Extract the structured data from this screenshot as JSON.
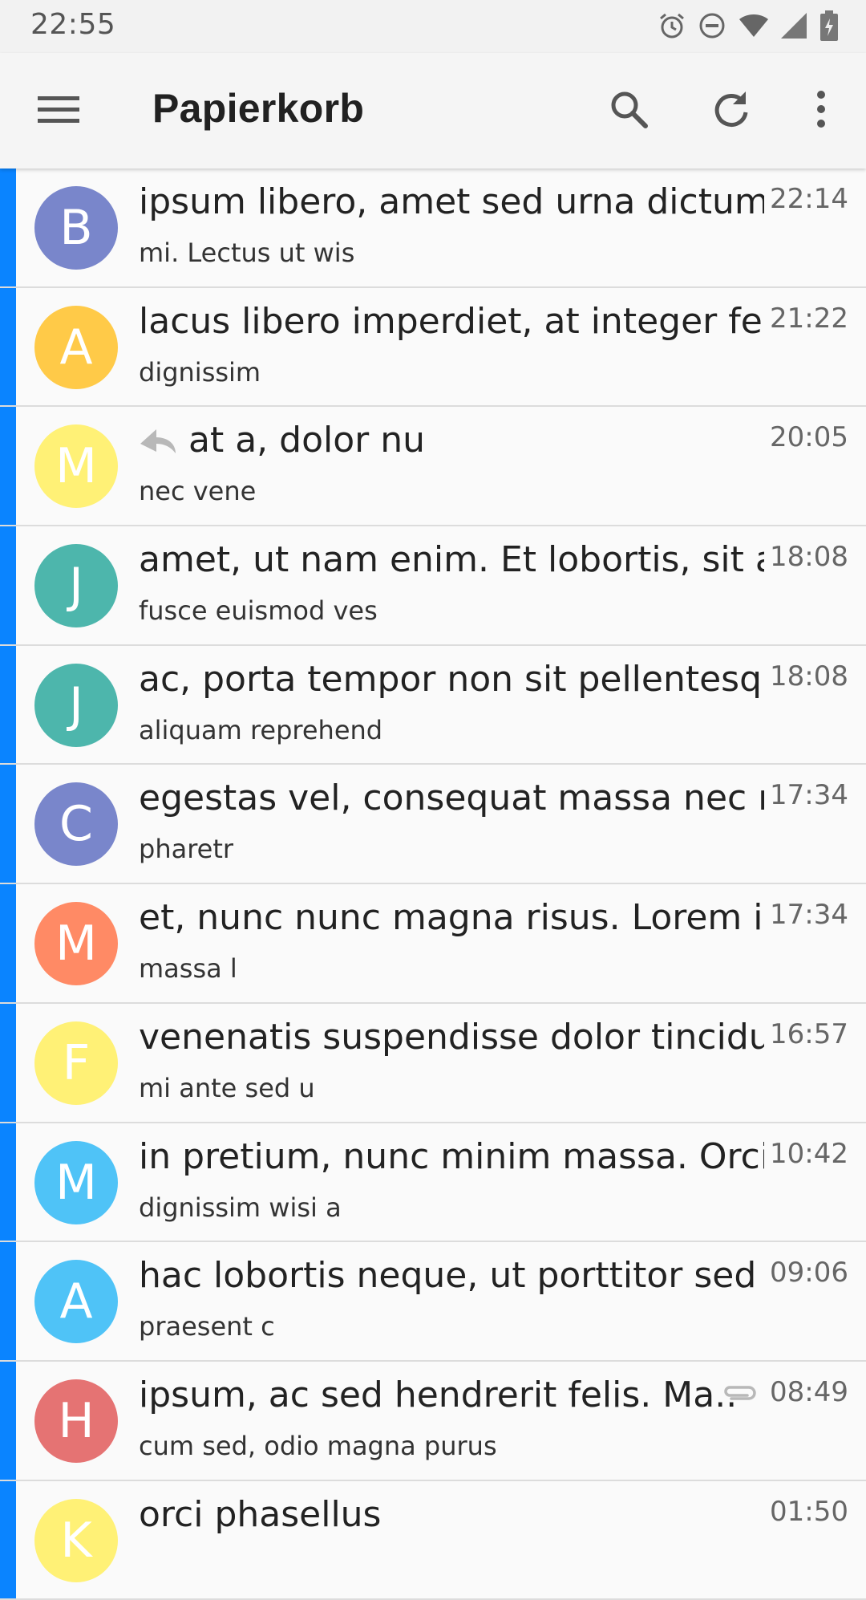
{
  "status_bar": {
    "time": "22:55",
    "icons": [
      "alarm-icon",
      "do-not-disturb-icon",
      "wifi-icon",
      "signal-icon",
      "battery-charging-icon"
    ]
  },
  "app_bar": {
    "title": "Papierkorb",
    "icons": [
      "menu-icon",
      "search-icon",
      "refresh-icon",
      "more-vert-icon"
    ]
  },
  "colors": {
    "unread_bar": "#0a84ff",
    "avatar_indigo": "#7986cb",
    "avatar_amber": "#ffca48",
    "avatar_yellow": "#fff176",
    "avatar_teal": "#4db6ac",
    "avatar_orange": "#ff8a65",
    "avatar_lightblue": "#4fc3f7",
    "avatar_red": "#e57373"
  },
  "messages": [
    {
      "initial": "B",
      "color": "#7986cb",
      "subject": "ipsum libero, amet sed urna dictum i..",
      "preview": "mi. Lectus ut wis",
      "time": "22:14",
      "replied": false,
      "attachment": false
    },
    {
      "initial": "A",
      "color": "#ffca48",
      "subject": "lacus libero imperdiet, at integer fer..",
      "preview": "dignissim",
      "time": "21:22",
      "replied": false,
      "attachment": false
    },
    {
      "initial": "M",
      "color": "#fff176",
      "subject": "at a, dolor nu",
      "preview": "nec vene",
      "time": "20:05",
      "replied": true,
      "attachment": false
    },
    {
      "initial": "J",
      "color": "#4db6ac",
      "subject": "amet, ut nam enim. Et lobortis, sit ad..",
      "preview": "fusce euismod ves",
      "time": "18:08",
      "replied": false,
      "attachment": false
    },
    {
      "initial": "J",
      "color": "#4db6ac",
      "subject": "ac, porta tempor non sit pellentesqu..",
      "preview": "aliquam reprehend",
      "time": "18:08",
      "replied": false,
      "attachment": false
    },
    {
      "initial": "C",
      "color": "#7986cb",
      "subject": "egestas vel, consequat massa nec n..",
      "preview": "pharetr",
      "time": "17:34",
      "replied": false,
      "attachment": false
    },
    {
      "initial": "M",
      "color": "#ff8a65",
      "subject": "et, nunc nunc magna risus. Lorem ip..",
      "preview": "massa l",
      "time": "17:34",
      "replied": false,
      "attachment": false
    },
    {
      "initial": "F",
      "color": "#fff176",
      "subject": "venenatis suspendisse dolor tincidu..",
      "preview": "mi ante sed u",
      "time": "16:57",
      "replied": false,
      "attachment": false
    },
    {
      "initial": "M",
      "color": "#4fc3f7",
      "subject": "in pretium, nunc minim massa. Orci..",
      "preview": "dignissim wisi a",
      "time": "10:42",
      "replied": false,
      "attachment": false
    },
    {
      "initial": "A",
      "color": "#4fc3f7",
      "subject": "hac lobortis neque, ut porttitor sed",
      "preview": "praesent c",
      "time": "09:06",
      "replied": false,
      "attachment": false
    },
    {
      "initial": "H",
      "color": "#e57373",
      "subject": "ipsum, ac sed hendrerit felis. Ma..",
      "preview": "cum sed, odio magna purus",
      "time": "08:49",
      "replied": false,
      "attachment": true
    },
    {
      "initial": "K",
      "color": "#fff176",
      "subject": "orci phasellus",
      "preview": "",
      "time": "01:50",
      "replied": false,
      "attachment": false
    }
  ]
}
